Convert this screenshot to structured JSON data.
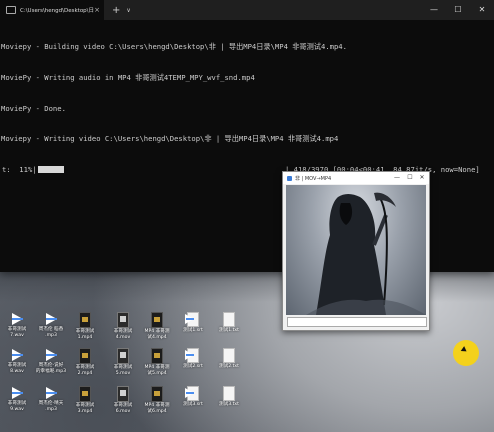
{
  "terminal": {
    "tab_title": "C:\\Users\\hengd\\Desktop\\日录",
    "tab_close": "×",
    "new_tab": "+",
    "dropdown": "∨",
    "minimize": "—",
    "maximize": "☐",
    "close": "✕",
    "lines": [
      "Moviepy - Building video C:\\Users\\hengd\\Desktop\\非 | 导出MP4日录\\MP4 非哥测试4.mp4.",
      "MoviePy - Writing audio in MP4 非哥测试4TEMP_MPY_wvf_snd.mp4",
      "MoviePy - Done.",
      "Moviepy - Writing video C:\\Users\\hengd\\Desktop\\非 | 导出MP4日录\\MP4 非哥测试4.mp4"
    ],
    "progress_prefix": "t:  11%|",
    "progress_suffix": "| 418/3970 [00:04<00:41, 84.87it/s, now=None]",
    "progress_fraction": 0.11
  },
  "preview": {
    "title": "非 | MOV→MP4",
    "minimize": "—",
    "maximize": "☐",
    "close": "✕"
  },
  "desktop_icons": [
    {
      "label": "非哥测试\n7.wav",
      "type": "wav"
    },
    {
      "label": "周杰伦 稻香\n.mp3",
      "type": "mp3"
    },
    {
      "label": "非哥测试\n1.mp4",
      "type": "mp4"
    },
    {
      "label": "非哥测试\n4.mov",
      "type": "mov"
    },
    {
      "label": "MP4 非哥测\n试4.mp4",
      "type": "mp4"
    },
    {
      "label": "测试1.srt",
      "type": "srt"
    },
    {
      "label": "测试1.txt",
      "type": "txt"
    },
    {
      "label": "非哥测试\n8.wav",
      "type": "wav"
    },
    {
      "label": "周杰伦-说好\n的幸福呢.mp3",
      "type": "mp3"
    },
    {
      "label": "非哥测试\n2.mp4",
      "type": "mp4"
    },
    {
      "label": "非哥测试\n5.mov",
      "type": "mov"
    },
    {
      "label": "MP4 非哥测\n试5.mp4",
      "type": "mp4"
    },
    {
      "label": "测试2.srt",
      "type": "srt"
    },
    {
      "label": "测试2.txt",
      "type": "txt"
    },
    {
      "label": "非哥测试\n9.wav",
      "type": "wav"
    },
    {
      "label": "周杰伦-晴天\n.mp3",
      "type": "mp3"
    },
    {
      "label": "非哥测试\n3.mp4",
      "type": "mp4"
    },
    {
      "label": "非哥测试\n6.mov",
      "type": "mov"
    },
    {
      "label": "MP4 非哥测\n试6.mp4",
      "type": "mp4"
    },
    {
      "label": "测试3.srt",
      "type": "srt"
    },
    {
      "label": "测试3.txt",
      "type": "txt"
    }
  ]
}
